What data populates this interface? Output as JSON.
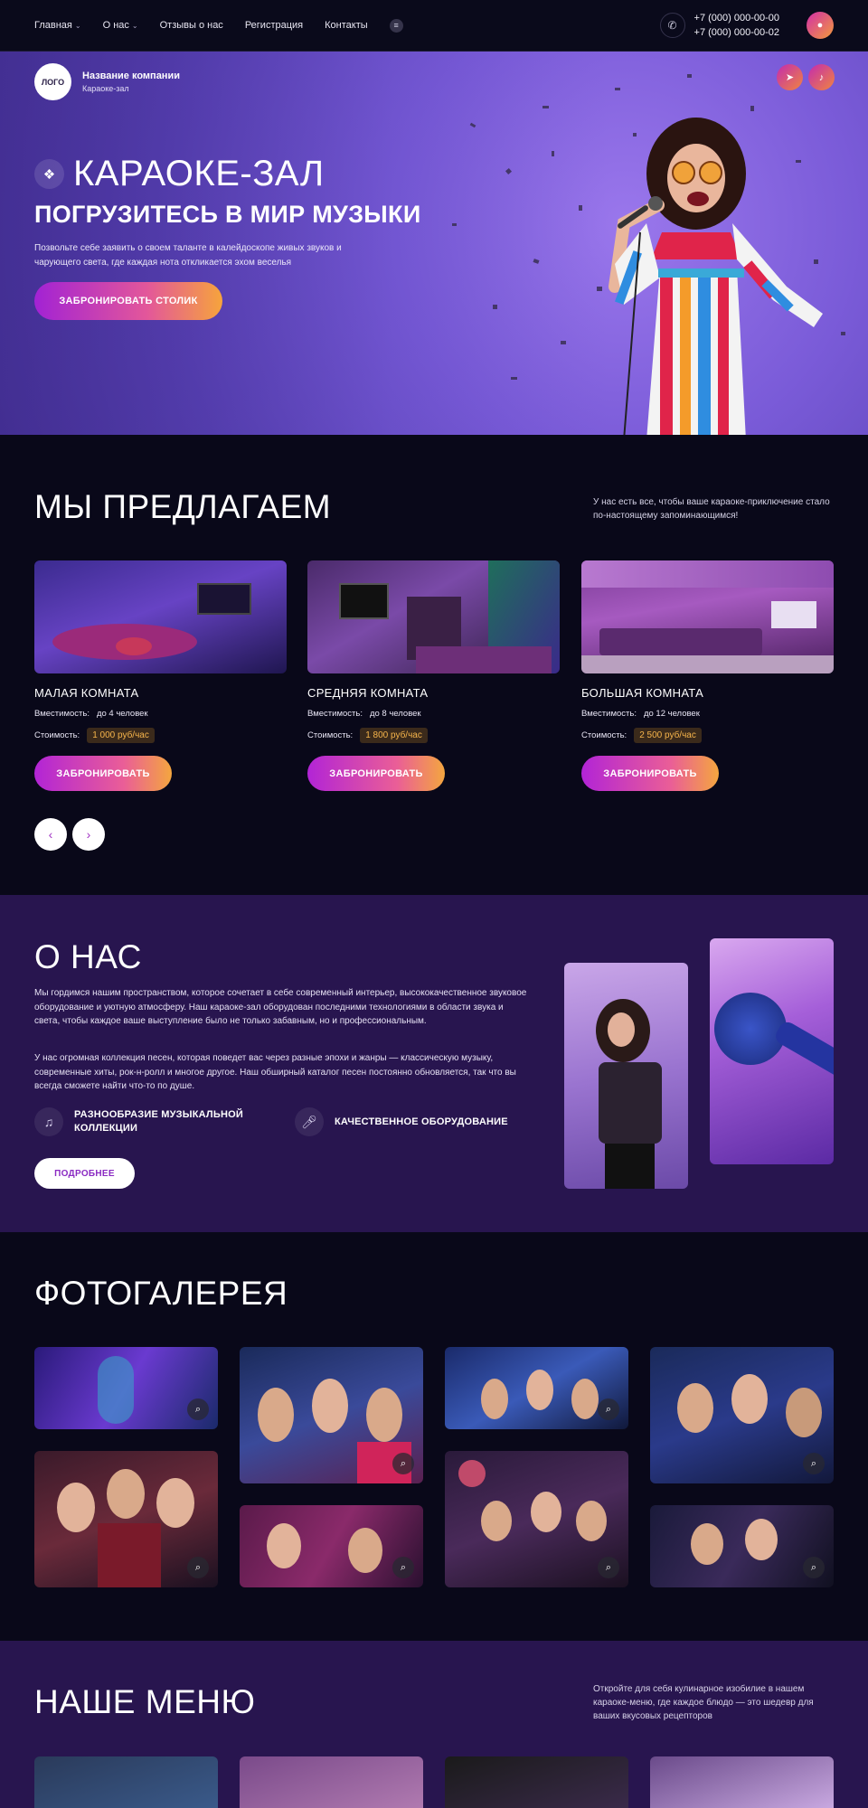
{
  "nav": {
    "links": [
      "Главная",
      "О нас",
      "Отзывы о нас",
      "Регистрация",
      "Контакты"
    ],
    "menu_icon": "menu-lines-icon",
    "phones": [
      "+7 (000) 000-00-00",
      "+7 (000) 000-00-02"
    ]
  },
  "hero": {
    "logo": "ЛОГО",
    "company_name": "Название компании",
    "company_type": "Караоке-зал",
    "title": "КАРАОКЕ-ЗАЛ",
    "subtitle": "ПОГРУЗИТЕСЬ В МИР МУЗЫКИ",
    "description": "Позвольте себе заявить о своем таланте в калейдоскопе живых звуков и чарующего света, где каждая нота откликается эхом веселья",
    "cta": "ЗАБРОНИРОВАТЬ СТОЛИК"
  },
  "services": {
    "title": "МЫ ПРЕДЛАГАЕМ",
    "note": "У нас есть все, чтобы ваше караоке-приключение стало по-настоящему запоминающимся!",
    "capacity_label": "Вместимость:",
    "price_label": "Стоимость:",
    "book_label": "ЗАБРОНИРОВАТЬ",
    "rooms": [
      {
        "name": "МАЛАЯ КОМНАТА",
        "capacity": "до 4 человек",
        "price": "1 000 руб/час"
      },
      {
        "name": "СРЕДНЯЯ КОМНАТА",
        "capacity": "до 8 человек",
        "price": "1 800 руб/час"
      },
      {
        "name": "БОЛЬШАЯ КОМНАТА",
        "capacity": "до 12 человек",
        "price": "2 500 руб/час"
      }
    ]
  },
  "about": {
    "title": "О НАС",
    "p1": "Мы гордимся нашим пространством, которое сочетает в себе современный интерьер, высококачественное звуковое оборудование и уютную атмосферу. Наш караоке-зал оборудован последними технологиями в области звука и света, чтобы каждое ваше выступление было не только забавным, но и профессиональным.",
    "p2": "У нас огромная коллекция песен, которая поведет вас через разные эпохи и жанры — классическую музыку, современные хиты, рок-н-ролл и многое другое. Наш обширный каталог песен постоянно обновляется, так что вы всегда сможете найти что-то по душе.",
    "feature1": "РАЗНООБРАЗИЕ МУЗЫКАЛЬНОЙ КОЛЛЕКЦИИ",
    "feature2": "КАЧЕСТВЕННОЕ ОБОРУДОВАНИЕ",
    "more": "ПОДРОБНЕЕ"
  },
  "gallery": {
    "title": "ФОТОГАЛЕРЕЯ"
  },
  "menu": {
    "title": "НАШЕ МЕНЮ",
    "note": "Откройте для себя кулинарное изобилие в нашем караоке-меню, где каждое блюдо — это шедевр для ваших вкусовых рецепторов"
  },
  "colors": {
    "background": "#090819",
    "about_bg": "#28154f",
    "accent_gradient_start": "#a222d4",
    "accent_gradient_end": "#f6a43c",
    "price_text": "#f6b44b"
  }
}
